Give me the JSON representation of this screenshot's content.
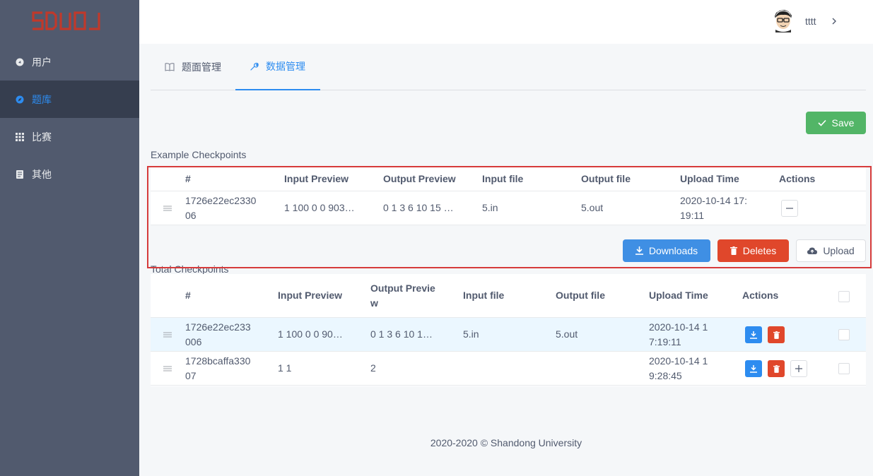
{
  "app": {
    "logo_text": "SDUOJ"
  },
  "sidebar": {
    "items": [
      {
        "label": "用户",
        "icon": "user-circle-icon",
        "active": false
      },
      {
        "label": "题库",
        "icon": "compass-icon",
        "active": true
      },
      {
        "label": "比赛",
        "icon": "grid-icon",
        "active": false
      },
      {
        "label": "其他",
        "icon": "document-icon",
        "active": false
      }
    ]
  },
  "header": {
    "username": "tttt",
    "avatar": "avatar-icon"
  },
  "tabs": [
    {
      "label": "题面管理",
      "icon": "book-icon",
      "active": false
    },
    {
      "label": "数据管理",
      "icon": "wrench-icon",
      "active": true
    }
  ],
  "toolbar": {
    "save_label": "Save"
  },
  "example": {
    "title": "Example Checkpoints",
    "columns": [
      "#",
      "Input Preview",
      "Output Preview",
      "Input file",
      "Output file",
      "Upload Time",
      "Actions"
    ],
    "rows": [
      {
        "id_line1": "1726e22ec2330",
        "id_line2": "06",
        "input": "1 100 0 0 903…",
        "output": "0 1 3 6 10 15 …",
        "infile": "5.in",
        "outfile": "5.out",
        "time_line1": "2020-10-14 17:",
        "time_line2": "19:11"
      }
    ],
    "buttons": {
      "downloads": "Downloads",
      "deletes": "Deletes",
      "upload": "Upload"
    }
  },
  "total": {
    "title": "Total Checkpoints",
    "columns": [
      "#",
      "Input Preview",
      "Output Previe",
      "w",
      "Input file",
      "Output file",
      "Upload Time",
      "Actions"
    ],
    "rows": [
      {
        "id_line1": "1726e22ec233",
        "id_line2": "006",
        "input": "1 100 0 0 90…",
        "output": "0 1 3 6 10 1…",
        "infile": "5.in",
        "outfile": "5.out",
        "time_line1": "2020-10-14 1",
        "time_line2": "7:19:11"
      },
      {
        "id_line1": "1728bcaffa330",
        "id_line2": "07",
        "input": "1 1",
        "output": "2",
        "infile": "",
        "outfile": "",
        "time_line1": "2020-10-14 1",
        "time_line2": "9:28:45"
      }
    ]
  },
  "footer": {
    "text": "2020-2020 © Shandong University"
  },
  "colors": {
    "primary": "#2d8cf0",
    "success": "#52b567",
    "danger": "#e0472b",
    "sidebar": "#515a6e"
  }
}
